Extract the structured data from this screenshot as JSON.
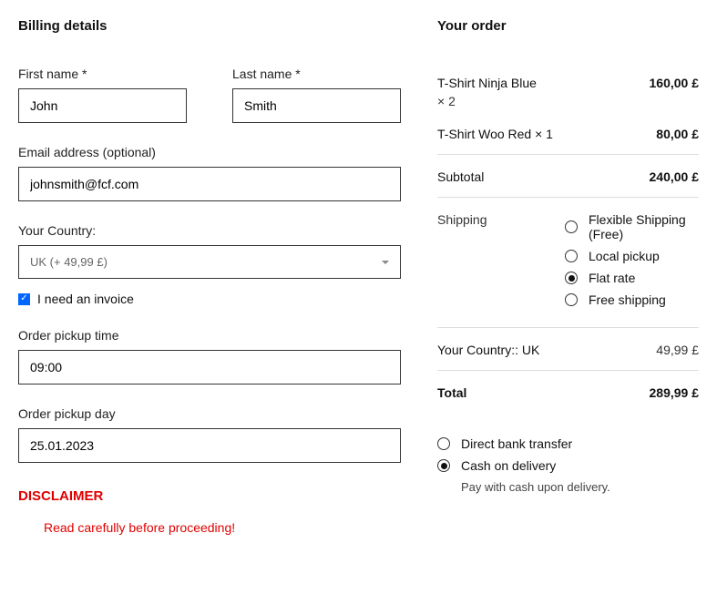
{
  "billing": {
    "heading": "Billing details",
    "firstName": {
      "label": "First name *",
      "value": "John"
    },
    "lastName": {
      "label": "Last name *",
      "value": "Smith"
    },
    "email": {
      "label": "Email address (optional)",
      "value": "johnsmith@fcf.com"
    },
    "country": {
      "label": "Your Country:",
      "selected": "UK (+ 49,99 £)"
    },
    "invoice": {
      "label": "I need an invoice",
      "checked": true
    },
    "pickupTime": {
      "label": "Order pickup time",
      "value": "09:00"
    },
    "pickupDay": {
      "label": "Order pickup day",
      "value": "25.01.2023"
    },
    "disclaimer": {
      "title": "DISCLAIMER",
      "text": "Read carefully before proceeding!"
    }
  },
  "order": {
    "heading": "Your order",
    "items": [
      {
        "name": "T-Shirt Ninja Blue",
        "qty": "× 2",
        "price": "160,00 £"
      },
      {
        "name": "T-Shirt Woo Red  × 1",
        "qty": "",
        "price": "80,00 £"
      }
    ],
    "subtotal": {
      "label": "Subtotal",
      "value": "240,00 £"
    },
    "shipping": {
      "label": "Shipping",
      "options": [
        {
          "label": "Flexible Shipping (Free)",
          "checked": false
        },
        {
          "label": "Local pickup",
          "checked": false
        },
        {
          "label": "Flat rate",
          "checked": true
        },
        {
          "label": "Free shipping",
          "checked": false
        }
      ]
    },
    "countryFee": {
      "label": "Your Country:: UK",
      "value": "49,99 £"
    },
    "total": {
      "label": "Total",
      "value": "289,99 £"
    },
    "payment": {
      "options": [
        {
          "label": "Direct bank transfer",
          "checked": false
        },
        {
          "label": "Cash on delivery",
          "checked": true
        }
      ],
      "note": "Pay with cash upon delivery."
    }
  }
}
